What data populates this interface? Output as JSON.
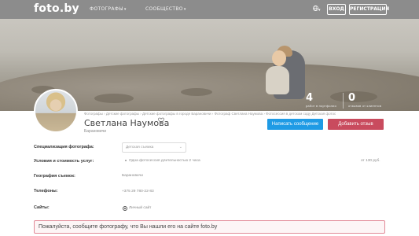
{
  "header": {
    "logo": "foto.by",
    "nav": [
      {
        "label": "ФОТОГРАФЫ",
        "caret": "▾"
      },
      {
        "label": "СООБЩЕСТВО",
        "caret": "▾"
      }
    ],
    "language_icon": "globe-icon",
    "language_caret": "▾",
    "login_label": "ВХОД",
    "register_label": "РЕГИСТРАЦИЯ"
  },
  "cover": {
    "stats": [
      {
        "value": "4",
        "label": "работ в портфолио"
      },
      {
        "value": "0",
        "label": "отзывов от клиентов"
      }
    ]
  },
  "profile": {
    "breadcrumb": "Фотографы › Детские фотографы › Детские фотографы в городе Барановичи › Фотограф Светлана Наумова › Фотосессия в детском саду Детская фотосессия",
    "name": "Светлана Наумова",
    "favorite_icon": "heart-icon",
    "city": "Барановичи",
    "message_button": "Написать сообщение",
    "review_button": "Добавить отзыв"
  },
  "info": {
    "specialization": {
      "label": "Специализация фотографа:",
      "value": "Детская съемка",
      "chevron": "⌄"
    },
    "services": {
      "label": "Условия и стоимость услуг:",
      "value": "Одна фотосессия длительностью 2 часа",
      "price": "от 130 руб."
    },
    "geography": {
      "label": "География съемок:",
      "value": "Барановичи"
    },
    "phone": {
      "label": "Телефоны:",
      "value": "+375 29 780-22-83"
    },
    "sites": {
      "label": "Сайты:",
      "value": "Личный сайт",
      "icon": "globe-icon"
    }
  },
  "notice": {
    "text": "Пожалуйста, сообщите фотографу, что Вы нашли его на сайте foto.by"
  },
  "colors": {
    "topbar": "#8c8c8c",
    "message_button": "#1f9be5",
    "review_button": "#c94b5e",
    "notice_border": "#e28a98"
  }
}
